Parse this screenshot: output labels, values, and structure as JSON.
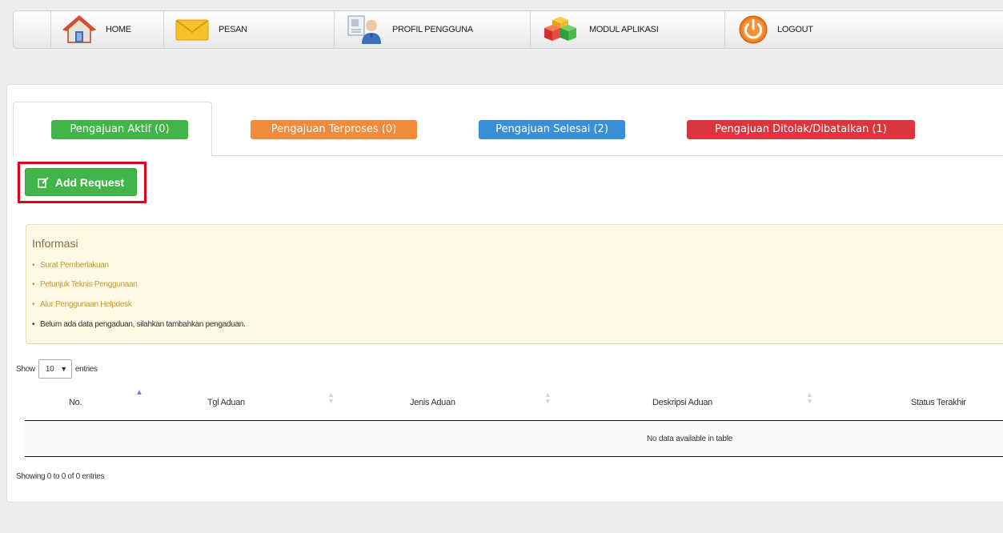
{
  "nav": {
    "items": [
      {
        "label": "HOME",
        "icon": "home-icon"
      },
      {
        "label": "PESAN",
        "icon": "envelope-icon"
      },
      {
        "label": "PROFIL PENGGUNA",
        "icon": "user-profile-icon"
      },
      {
        "label": "MODUL APLIKASI",
        "icon": "cubes-icon"
      },
      {
        "label": "LOGOUT",
        "icon": "power-icon"
      }
    ]
  },
  "tabs": [
    {
      "label": "Pengajuan Aktif (0)",
      "color": "#42b549"
    },
    {
      "label": "Pengajuan Terproses (0)",
      "color": "#f28a3c"
    },
    {
      "label": "Pengajuan Selesai (2)",
      "color": "#3a8fd6"
    },
    {
      "label": "Pengajuan Ditolak/Dibatalkan (1)",
      "color": "#d9363e"
    }
  ],
  "add_button": {
    "label": "Add Request",
    "icon": "edit-icon"
  },
  "info": {
    "title": "Informasi",
    "links": [
      "Surat Pemberlakuan",
      "Petunjuk Teknis Penggunaan",
      "Alur Penggunaan Helpdesk"
    ],
    "notice": "Belum ada data pengaduan, silahkan tambahkan pengaduan."
  },
  "table": {
    "show_label": "Show",
    "page_size": "10",
    "entries_label": "entries",
    "columns": [
      "No.",
      "Tgl Aduan",
      "Jenis Aduan",
      "Deskripsi Aduan",
      "Status Terakhir"
    ],
    "empty_message": "No data available in table",
    "footer": "Showing 0 to 0 of 0 entries"
  }
}
